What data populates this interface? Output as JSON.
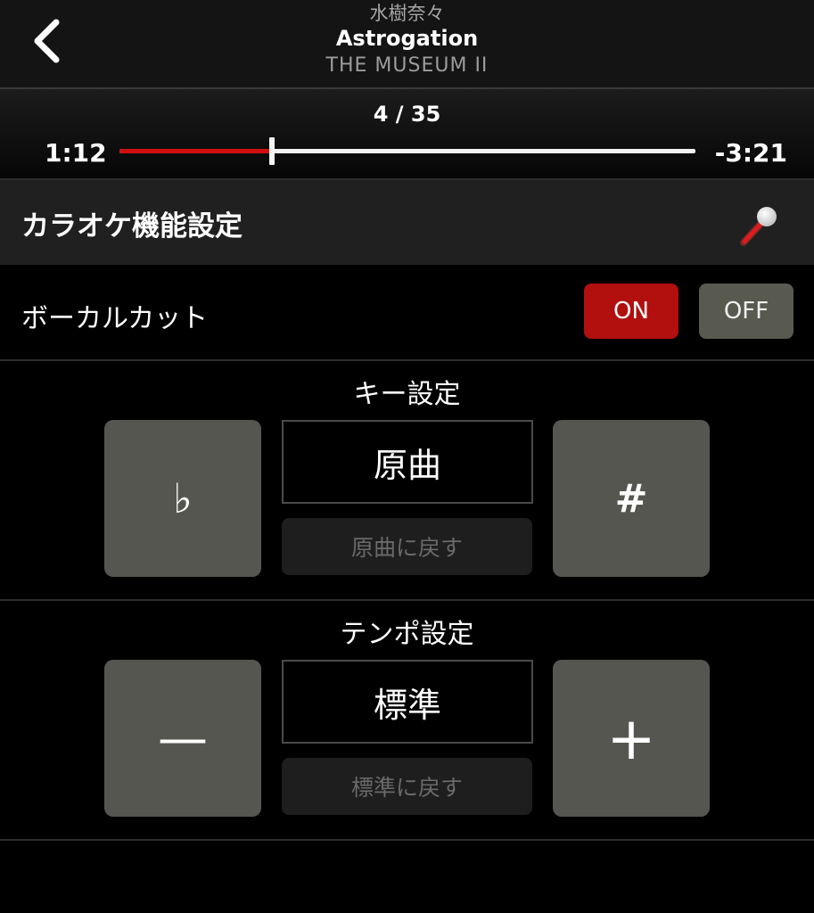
{
  "header": {
    "artist": "水樹奈々",
    "title": "Astrogation",
    "album": "THE MUSEUM II"
  },
  "player": {
    "track_counter": "4 / 35",
    "elapsed": "1:12",
    "remaining": "-3:21",
    "progress_fraction": 0.265
  },
  "karaoke": {
    "section_title": "カラオケ機能設定",
    "vocal_cut": {
      "label": "ボーカルカット",
      "on_label": "ON",
      "off_label": "OFF",
      "selected": "ON"
    },
    "key": {
      "label": "キー設定",
      "flat_symbol": "♭",
      "sharp_symbol": "#",
      "value": "原曲",
      "reset_label": "原曲に戻す"
    },
    "tempo": {
      "label": "テンポ設定",
      "minus_symbol": "—",
      "plus_symbol": "+",
      "value": "標準",
      "reset_label": "標準に戻す"
    }
  },
  "colors": {
    "accent_red": "#b20f0f",
    "progress_red": "#d01010",
    "button_gray": "#565650"
  },
  "icons": {
    "back": "chevron-left-icon",
    "microphone": "microphone-icon"
  }
}
